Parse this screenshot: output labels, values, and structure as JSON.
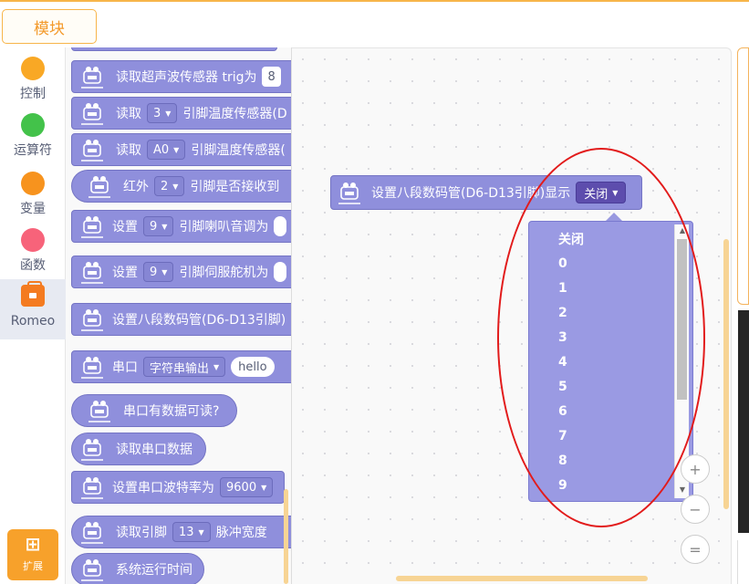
{
  "topbar": {
    "module_tab": "模块"
  },
  "categories": [
    {
      "label": "控制",
      "color": "#f9a825"
    },
    {
      "label": "运算符",
      "color": "#43c24a"
    },
    {
      "label": "变量",
      "color": "#f7931e"
    },
    {
      "label": "函数",
      "color": "#f7637a"
    },
    {
      "label": "Romeo",
      "color": "#f47b20",
      "icon": "romeo-briefcase-icon",
      "active": true
    }
  ],
  "extension_button": {
    "label": "扩展",
    "icon": "extension-plus-icon"
  },
  "palette": {
    "blocks": [
      {
        "parts": [
          "读取超声波传感器 trig为"
        ],
        "input": "8"
      },
      {
        "parts": [
          "读取",
          "引脚温度传感器(D"
        ],
        "dropdown": "3"
      },
      {
        "parts": [
          "读取",
          "引脚温度传感器("
        ],
        "dropdown": "A0"
      },
      {
        "parts": [
          "红外",
          "引脚是否接收到"
        ],
        "dropdown": "2"
      },
      {
        "parts": [
          "设置",
          "引脚喇叭音调为"
        ],
        "dropdown": "9"
      },
      {
        "parts": [
          "设置",
          "引脚伺服舵机为"
        ],
        "dropdown": "9"
      },
      {
        "parts": [
          "设置八段数码管(D6-D13引脚)"
        ]
      },
      {
        "parts": [
          "串口"
        ],
        "dropdown": "字符串输出",
        "text_input": "hello"
      },
      {
        "parts": [
          "串口有数据可读?"
        ]
      },
      {
        "parts": [
          "读取串口数据"
        ]
      },
      {
        "parts": [
          "设置串口波特率为"
        ],
        "dropdown": "9600"
      },
      {
        "parts": [
          "读取引脚",
          "脉冲宽度"
        ],
        "dropdown": "13"
      },
      {
        "parts": [
          "系统运行时间"
        ]
      }
    ]
  },
  "canvas_block": {
    "label": "设置八段数码管(D6-D13引脚)显示",
    "dropdown_value": "关闭"
  },
  "dropdown_menu": {
    "options": [
      "关闭",
      "0",
      "1",
      "2",
      "3",
      "4",
      "5",
      "6",
      "7",
      "8",
      "9"
    ]
  },
  "zoom_controls": {
    "zoom_in": "+",
    "zoom_out": "−",
    "reset": "="
  },
  "colors": {
    "block": "#8f8fdc",
    "dropdown_menu": "#9a9ae3",
    "accent": "#f7a12b",
    "highlight": "#e21b1b"
  }
}
